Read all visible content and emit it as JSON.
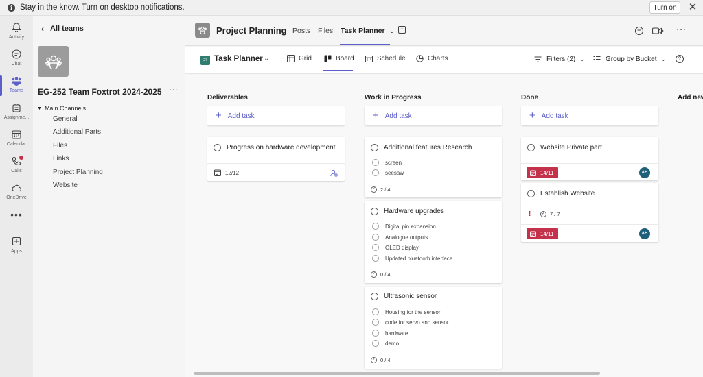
{
  "notification": {
    "message": "Stay in the know. Turn on desktop notifications.",
    "turn_on_label": "Turn on",
    "info_glyph": "i",
    "close_glyph": "✕"
  },
  "rail": {
    "items": [
      {
        "label": "Activity",
        "icon": "bell-icon"
      },
      {
        "label": "Chat",
        "icon": "chat-icon"
      },
      {
        "label": "Teams",
        "icon": "teams-icon",
        "active": true
      },
      {
        "label": "Assignme...",
        "icon": "assignments-icon"
      },
      {
        "label": "Calendar",
        "icon": "calendar-icon"
      },
      {
        "label": "Calls",
        "icon": "phone-icon",
        "badge": true
      },
      {
        "label": "OneDrive",
        "icon": "cloud-icon"
      },
      {
        "label": "Apps",
        "icon": "apps-icon"
      }
    ],
    "more_glyph": "•••"
  },
  "side": {
    "back_label": "All teams",
    "back_glyph": "‹",
    "team_name": "EG-252 Team Foxtrot 2024-2025",
    "more_glyph": "···",
    "section_label": "Main Channels",
    "section_glyph": "▼",
    "channels": [
      "General",
      "Additional Parts",
      "Files",
      "Links",
      "Project Planning",
      "Website"
    ]
  },
  "header": {
    "title": "Project Planning",
    "tabs": [
      "Posts",
      "Files",
      "Task Planner"
    ],
    "active_tab": "Task Planner",
    "tab_caret": "⌄",
    "add_glyph": "+",
    "more_glyph": "···"
  },
  "toolbar": {
    "plan_name": "Task Planner",
    "plan_badge": "27",
    "plan_caret": "⌄",
    "views": [
      "Grid",
      "Board",
      "Schedule",
      "Charts"
    ],
    "active_view": "Board",
    "filters_label": "Filters (2)",
    "group_label": "Group by Bucket",
    "caret": "⌄",
    "help_glyph": "?"
  },
  "board": {
    "add_task_label": "Add task",
    "add_glyph": "+",
    "check_glyph": "✓",
    "urgent_glyph": "!",
    "buckets": [
      {
        "name": "Deliverables",
        "tasks": [
          {
            "title": "Progress on hardware development",
            "date": "12/12",
            "date_style": "normal",
            "checklist": [],
            "assign_icon": true
          }
        ]
      },
      {
        "name": "Work in Progress",
        "tasks": [
          {
            "title": "Additional features Research",
            "checklist": [
              "screen",
              "seesaw"
            ],
            "progress": "2 / 4"
          },
          {
            "title": "Hardware upgrades",
            "checklist": [
              "Digital pin expansion",
              "Analogue outputs",
              "OLED display",
              "Updated bluetooth interface"
            ],
            "progress": "0 / 4"
          },
          {
            "title": "Ultrasonic sensor",
            "checklist": [
              "Housing for the sensor",
              "code for servo and sensor",
              "hardware",
              "demo"
            ],
            "progress": "0 / 4"
          }
        ]
      },
      {
        "name": "Done",
        "tasks": [
          {
            "title": "Website Private part",
            "date": "14/11",
            "date_style": "late",
            "assignee": "AH",
            "checklist": []
          },
          {
            "title": "Establish Website",
            "date": "14/11",
            "date_style": "late",
            "assignee": "AH",
            "progress": "7 / 7",
            "urgent": true,
            "checklist": []
          }
        ]
      },
      {
        "name": "Add new bucket",
        "tasks": []
      }
    ]
  },
  "colors": {
    "accent": "#5b5fc7",
    "late": "#c4314b",
    "avatar": "#1f5f7a"
  }
}
